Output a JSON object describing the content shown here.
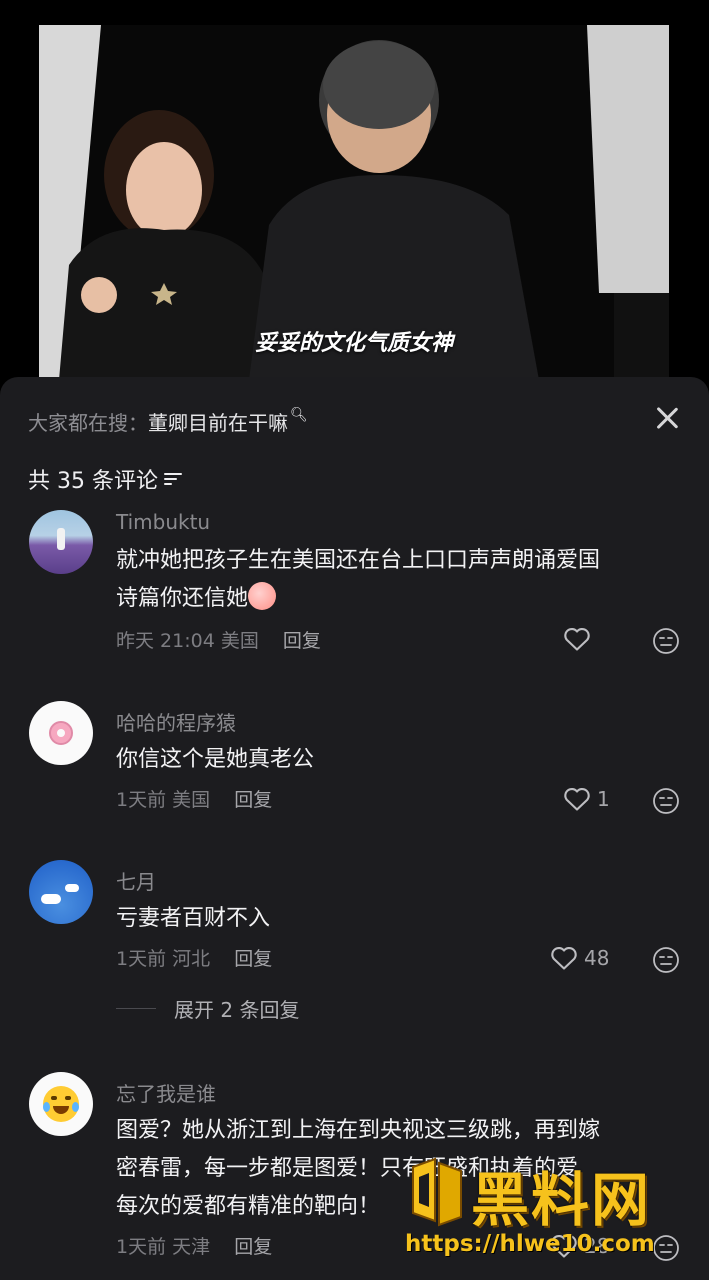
{
  "video": {
    "subtitle": "妥妥的文化气质女神"
  },
  "sheet": {
    "search_prefix": "大家都在搜：",
    "search_keyword": "董卿目前在干嘛",
    "comment_count_label": "共 35 条评论"
  },
  "comments": [
    {
      "username": "Timbuktu",
      "text_line1": "就冲她把孩子生在美国还在台上口口声声朗诵爱国",
      "text_line2": "诗篇你还信她",
      "time": "昨天 21:04",
      "location": "美国",
      "reply": "回复",
      "likes": ""
    },
    {
      "username": "哈哈的程序猿",
      "text_line1": "你信这个是她真老公",
      "time": "1天前",
      "location": "美国",
      "reply": "回复",
      "likes": "1"
    },
    {
      "username": "七月",
      "text_line1": "亏妻者百财不入",
      "time": "1天前",
      "location": "河北",
      "reply": "回复",
      "likes": "48",
      "expand_label": "展开 2 条回复"
    },
    {
      "username": "忘了我是谁",
      "text_line1": "图爱？她从浙江到上海在到央视这三级跳，再到嫁",
      "text_line2": "密春雷，每一步都是图爱！只有旺盛和执着的爱",
      "text_line3": "每次的爱都有精准的靶向！",
      "time": "1天前",
      "location": "天津",
      "reply": "回复",
      "likes": "28"
    }
  ],
  "watermark": {
    "title": "黑料网",
    "url": "https://hlwe10.com"
  },
  "colors": {
    "sheet_bg": "#1c1c1f",
    "watermark": "#f6c21c"
  },
  "icons": [
    "search-icon",
    "close-icon",
    "sort-icon",
    "heart-icon",
    "face-icon"
  ]
}
